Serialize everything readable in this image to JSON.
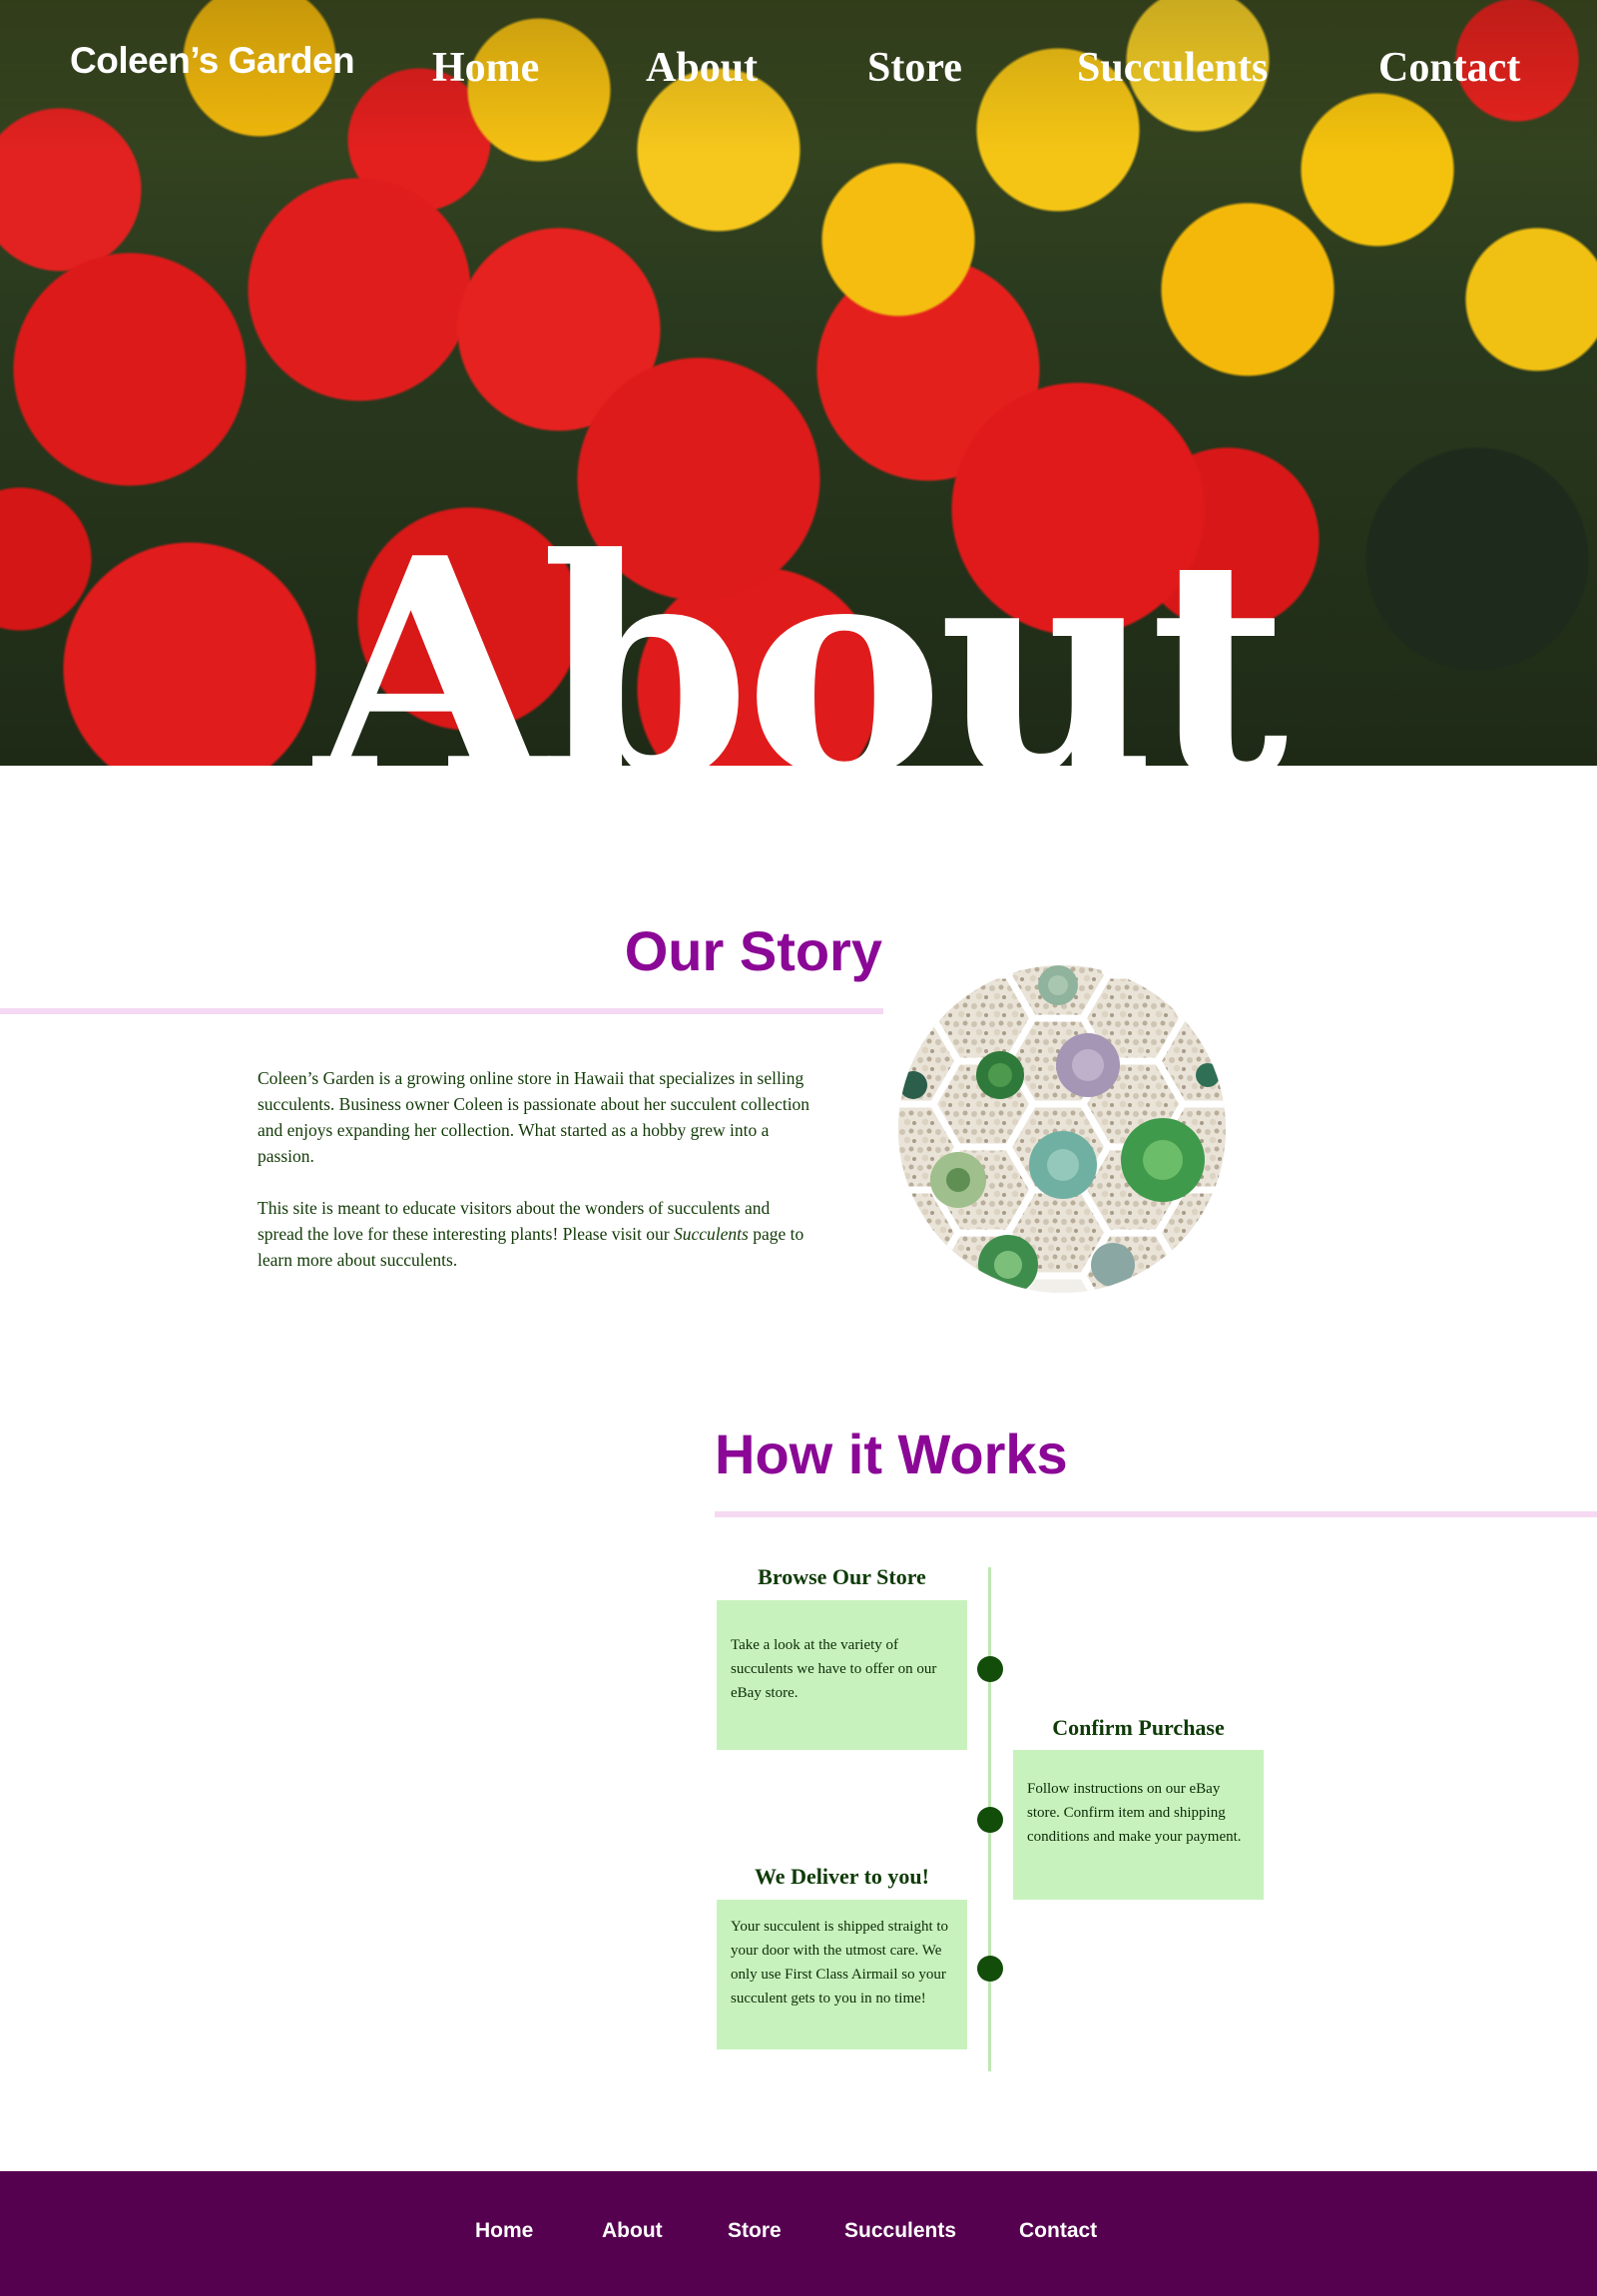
{
  "header": {
    "brand": "Coleen’s Garden",
    "nav": [
      "Home",
      "About",
      "Store",
      "Succulents",
      "Contact"
    ]
  },
  "hero": {
    "title": "About",
    "image": "red-and-yellow-cactus-photo"
  },
  "story": {
    "heading": "Our Story",
    "paragraph1": "Coleen’s Garden is a growing online store in Hawaii that specializes in selling succulents. Business owner Coleen is passionate about her succulent collection and enjoys expanding her collection. What started as a hobby grew into a passion.",
    "paragraph2_before": "This site is meant to educate visitors about the wonders of succulents and spread the love for these interesting plants! Please visit our ",
    "paragraph2_link": "Succulents",
    "paragraph2_after": " page to learn more about succulents.",
    "image": "succulents-in-hexagon-planters-photo"
  },
  "how_it_works": {
    "heading": "How it Works",
    "steps": [
      {
        "title": "Browse Our Store",
        "text": "Take a look at the variety of succulents we have to offer on our eBay store."
      },
      {
        "title": "Confirm Purchase",
        "text": "Follow instructions on our eBay store. Confirm item and shipping conditions and make your payment."
      },
      {
        "title": "We Deliver to you!",
        "text": "Your succulent is shipped straight to your door with the utmost care. We only use First Class Airmail so your succulent gets to you in no time!"
      }
    ]
  },
  "footer": {
    "nav": [
      "Home",
      "About",
      "Store",
      "Succulents",
      "Contact"
    ]
  },
  "colors": {
    "heading_purple": "#8b0896",
    "rule_pink": "#f5d9f3",
    "body_green": "#123a07",
    "step_box_green": "#c8f2bd",
    "dot_green": "#124d0a",
    "footer_purple": "#560050"
  }
}
